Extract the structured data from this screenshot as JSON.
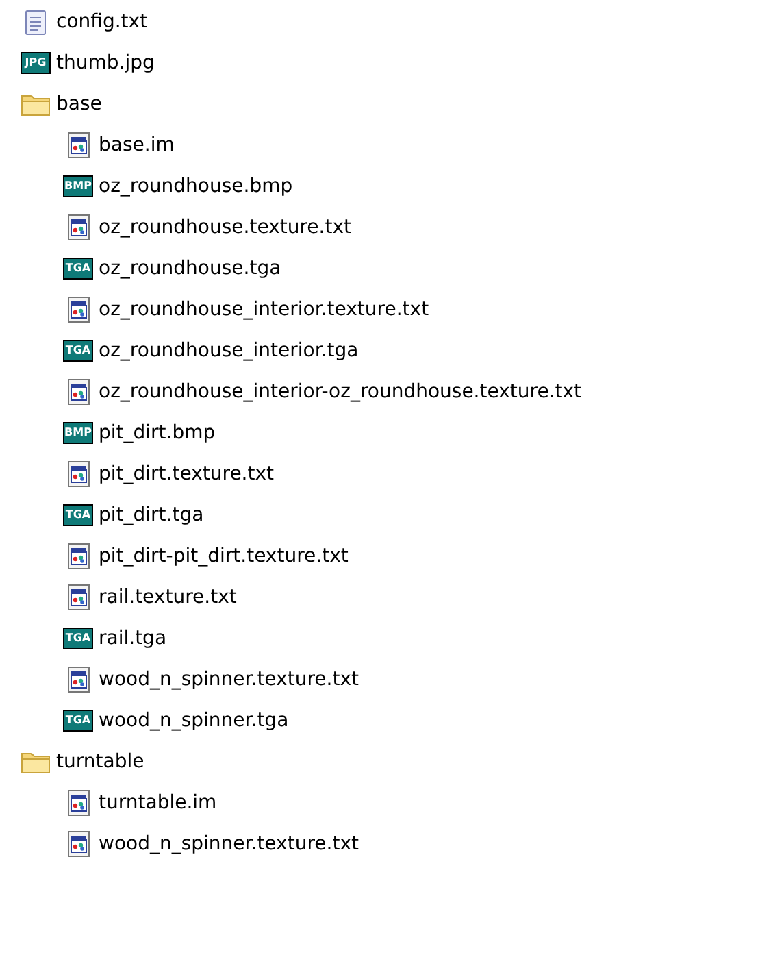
{
  "tree": [
    {
      "name": "config.txt",
      "kind": "text"
    },
    {
      "name": "thumb.jpg",
      "kind": "badge",
      "badge": "JPG"
    },
    {
      "name": "base",
      "kind": "folder",
      "children": [
        {
          "name": "base.im",
          "kind": "doc"
        },
        {
          "name": "oz_roundhouse.bmp",
          "kind": "badge",
          "badge": "BMP"
        },
        {
          "name": "oz_roundhouse.texture.txt",
          "kind": "doc"
        },
        {
          "name": "oz_roundhouse.tga",
          "kind": "badge",
          "badge": "TGA"
        },
        {
          "name": "oz_roundhouse_interior.texture.txt",
          "kind": "doc"
        },
        {
          "name": "oz_roundhouse_interior.tga",
          "kind": "badge",
          "badge": "TGA"
        },
        {
          "name": "oz_roundhouse_interior-oz_roundhouse.texture.txt",
          "kind": "doc"
        },
        {
          "name": "pit_dirt.bmp",
          "kind": "badge",
          "badge": "BMP"
        },
        {
          "name": "pit_dirt.texture.txt",
          "kind": "doc"
        },
        {
          "name": "pit_dirt.tga",
          "kind": "badge",
          "badge": "TGA"
        },
        {
          "name": "pit_dirt-pit_dirt.texture.txt",
          "kind": "doc"
        },
        {
          "name": "rail.texture.txt",
          "kind": "doc"
        },
        {
          "name": "rail.tga",
          "kind": "badge",
          "badge": "TGA"
        },
        {
          "name": "wood_n_spinner.texture.txt",
          "kind": "doc"
        },
        {
          "name": "wood_n_spinner.tga",
          "kind": "badge",
          "badge": "TGA"
        }
      ]
    },
    {
      "name": "turntable",
      "kind": "folder",
      "children": [
        {
          "name": "turntable.im",
          "kind": "doc"
        },
        {
          "name": "wood_n_spinner.texture.txt",
          "kind": "doc"
        }
      ]
    }
  ]
}
